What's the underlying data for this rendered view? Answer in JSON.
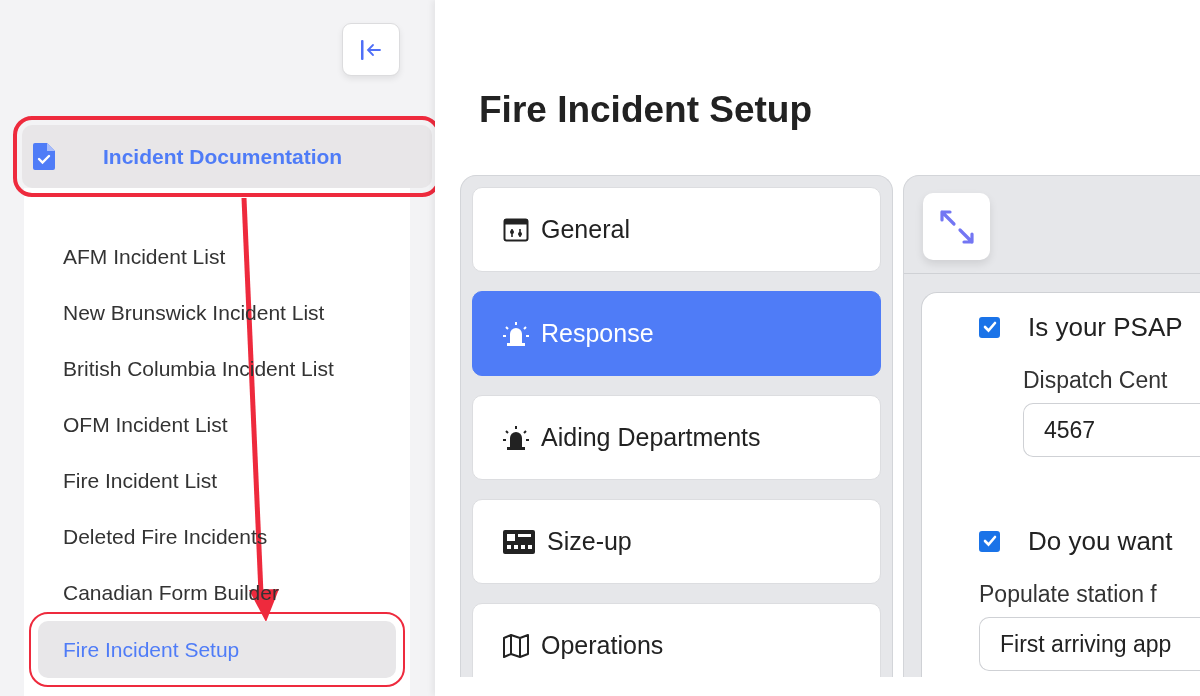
{
  "sidebar": {
    "menu_group": {
      "label": "Incident Documentation",
      "expanded": true,
      "highlighted": true,
      "items": [
        {
          "label": "AFM Incident List",
          "selected": false,
          "highlighted": false
        },
        {
          "label": "New Brunswick Incident List",
          "selected": false,
          "highlighted": false
        },
        {
          "label": "British Columbia Incident List",
          "selected": false,
          "highlighted": false
        },
        {
          "label": "OFM Incident List",
          "selected": false,
          "highlighted": false
        },
        {
          "label": "Fire Incident List",
          "selected": false,
          "highlighted": false
        },
        {
          "label": "Deleted Fire Incidents",
          "selected": false,
          "highlighted": false
        },
        {
          "label": "Canadian Form Builder",
          "selected": false,
          "highlighted": false
        },
        {
          "label": "Fire Incident Setup",
          "selected": true,
          "highlighted": true
        }
      ]
    }
  },
  "page_title": "Fire Incident Setup",
  "tabs": [
    {
      "label": "General",
      "selected": false
    },
    {
      "label": "Response",
      "selected": true
    },
    {
      "label": "Aiding Departments",
      "selected": false
    },
    {
      "label": "Size-up",
      "selected": false
    },
    {
      "label": "Operations",
      "selected": false
    }
  ],
  "form": {
    "fields": [
      {
        "kind": "checkbox",
        "label": "Is your PSAP",
        "checked": true,
        "children": [
          {
            "kind": "text-field",
            "label": "Dispatch Cent",
            "value": "4567"
          }
        ]
      },
      {
        "kind": "checkbox",
        "label": "Do you want",
        "checked": true
      },
      {
        "kind": "text-field",
        "label": "Populate station f",
        "value": "First arriving app"
      }
    ]
  },
  "annotations": [
    {
      "kind": "arrow"
    }
  ]
}
